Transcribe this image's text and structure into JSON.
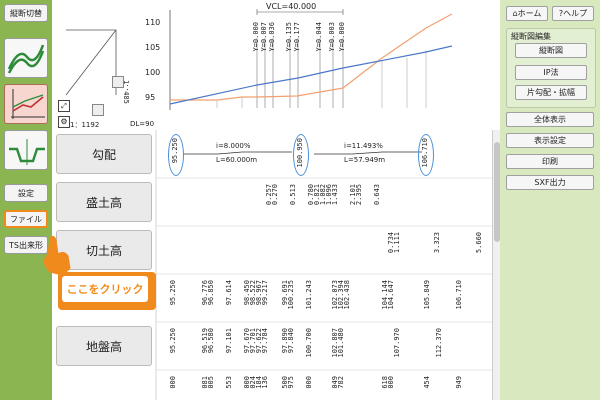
{
  "left_sidebar": {
    "top_button": "縦断切替",
    "settings_button": "設定",
    "file_button": "ファイル",
    "ts_button": "TS出来形"
  },
  "right_sidebar": {
    "home_button": "ホーム",
    "help_button": "ヘルプ",
    "group_title": "縦断図編集",
    "group_buttons": [
      "縦断図",
      "IP法",
      "片勾配・拡幅"
    ],
    "buttons": [
      "全体表示",
      "表示設定",
      "印刷",
      "SXF出力"
    ]
  },
  "profile": {
    "vcl_label": "VCL=40.000",
    "dl_label": "DL=90",
    "y_ticks": [
      "110",
      "105",
      "100",
      "95"
    ],
    "scale_vertical": "1：485",
    "scale_horizontal": "1：1192",
    "y_labels": [
      "Y=0.000",
      "Y=0.007",
      "Y=0.036",
      "Y=0.135",
      "Y=0.177",
      "Y=0.044",
      "Y=0.003",
      "Y=0.000"
    ]
  },
  "rows": {
    "gradient": {
      "label": "勾配",
      "values": [
        "95.250",
        "100.950",
        "106.710"
      ],
      "seg1": [
        "i=8.000%",
        "L=60.000m"
      ],
      "seg2": [
        "i=11.493%",
        "L=57.949m"
      ]
    },
    "fill": {
      "label": "盛土高",
      "values": [
        "0.257",
        "0.270",
        "0.513",
        "0.780",
        "0.821",
        "1.082",
        "1.096",
        "1.433",
        "2.101",
        "2.395",
        "0.643"
      ]
    },
    "cut": {
      "label": "切土高",
      "values": [
        "0.734",
        "1.111",
        "3.323",
        "5.660"
      ]
    },
    "plan": {
      "values": [
        "95.250",
        "96.776",
        "96.850",
        "97.614",
        "98.450",
        "98.522",
        "98.967",
        "99.217",
        "99.691",
        "100.235",
        "101.243",
        "102.073",
        "102.394",
        "102.438",
        "104.144",
        "104.647",
        "105.849",
        "106.710"
      ]
    },
    "ground": {
      "label": "地盤高",
      "values": [
        "95.250",
        "96.519",
        "96.580",
        "97.101",
        "97.670",
        "97.701",
        "97.622",
        "97.784",
        "97.890",
        "97.840",
        "100.700",
        "102.807",
        "101.480",
        "107.970",
        "112.370"
      ]
    },
    "bottom": {
      "values": [
        "000",
        "081",
        "005",
        "553",
        "000",
        "024",
        "184",
        "136",
        "500",
        "975",
        "000",
        "049",
        "782",
        "618",
        "000",
        "454",
        "949"
      ]
    }
  },
  "callout": {
    "text": "ここをクリック"
  },
  "colors": {
    "left_bg": "#8bb550",
    "right_bg": "#d8e8bf",
    "callout": "#f08a1c",
    "plan_line": "#4a78c8",
    "ground_line": "#f2a070"
  }
}
